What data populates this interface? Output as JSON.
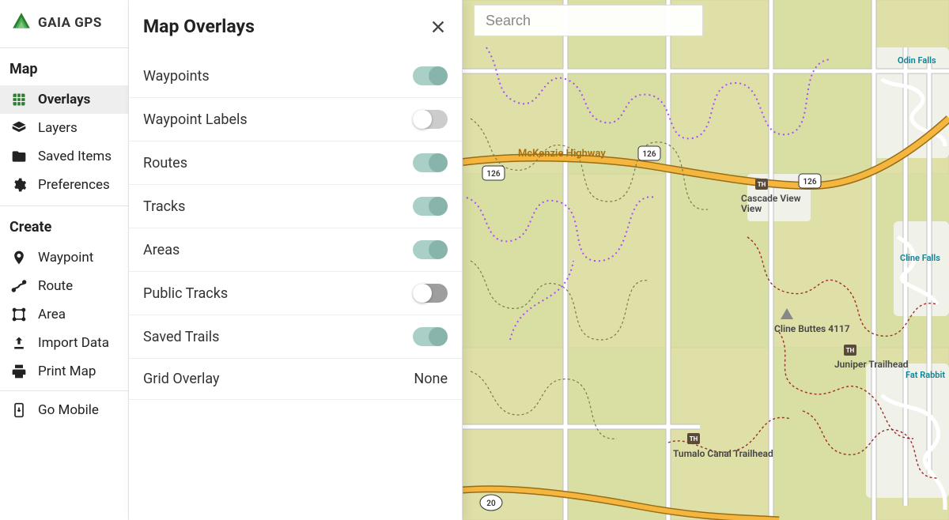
{
  "brand": {
    "name": "GAIA GPS"
  },
  "sidebar": {
    "sections": {
      "map": {
        "title": "Map",
        "items": [
          {
            "label": "Overlays",
            "icon": "grid-icon",
            "active": true
          },
          {
            "label": "Layers",
            "icon": "layers-icon",
            "active": false
          },
          {
            "label": "Saved Items",
            "icon": "folder-icon",
            "active": false
          },
          {
            "label": "Preferences",
            "icon": "gear-icon",
            "active": false
          }
        ]
      },
      "create": {
        "title": "Create",
        "items": [
          {
            "label": "Waypoint",
            "icon": "pin-icon"
          },
          {
            "label": "Route",
            "icon": "route-icon"
          },
          {
            "label": "Area",
            "icon": "area-icon"
          },
          {
            "label": "Import Data",
            "icon": "upload-icon"
          },
          {
            "label": "Print Map",
            "icon": "print-icon"
          }
        ]
      }
    },
    "go_mobile_label": "Go Mobile"
  },
  "panel": {
    "title": "Map Overlays",
    "rows": [
      {
        "label": "Waypoints",
        "type": "toggle",
        "state": "on"
      },
      {
        "label": "Waypoint Labels",
        "type": "toggle",
        "state": "off"
      },
      {
        "label": "Routes",
        "type": "toggle",
        "state": "on"
      },
      {
        "label": "Tracks",
        "type": "toggle",
        "state": "on"
      },
      {
        "label": "Areas",
        "type": "toggle",
        "state": "on"
      },
      {
        "label": "Public Tracks",
        "type": "toggle",
        "state": "off_alt"
      },
      {
        "label": "Saved Trails",
        "type": "toggle",
        "state": "on"
      },
      {
        "label": "Grid Overlay",
        "type": "value",
        "value": "None"
      }
    ]
  },
  "map": {
    "search_placeholder": "Search",
    "highway_label": "McKenzie Highway",
    "shields": [
      "126",
      "126",
      "126",
      "20"
    ],
    "places": [
      {
        "label": "Cascade View"
      },
      {
        "label": "Juniper Trailhead"
      },
      {
        "label": "Tumalo Canal Trailhead"
      },
      {
        "label": "Cline Buttes 4117"
      }
    ],
    "falls": [
      {
        "label": "Odin Falls"
      },
      {
        "label": "Cline Falls"
      },
      {
        "label": "Fat Rabbit"
      }
    ]
  }
}
